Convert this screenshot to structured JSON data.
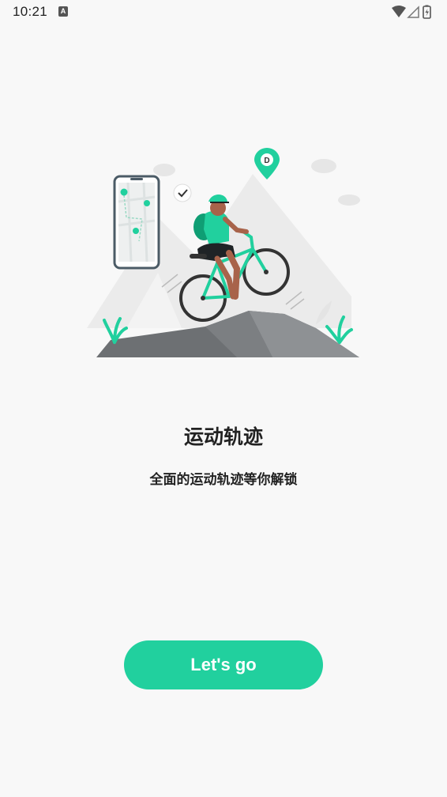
{
  "status_bar": {
    "time": "10:21",
    "notification_icon_letter": "A",
    "icons": [
      "wifi-icon",
      "cell-signal-icon",
      "battery-charging-icon"
    ]
  },
  "onboarding": {
    "illustration": "cyclist-mountain-illustration",
    "title": "运动轨迹",
    "subtitle": "全面的运动轨迹等你解锁",
    "button_label": "Let's go"
  },
  "colors": {
    "accent": "#21d09e",
    "background": "#f8f8f8",
    "text": "#222222"
  }
}
